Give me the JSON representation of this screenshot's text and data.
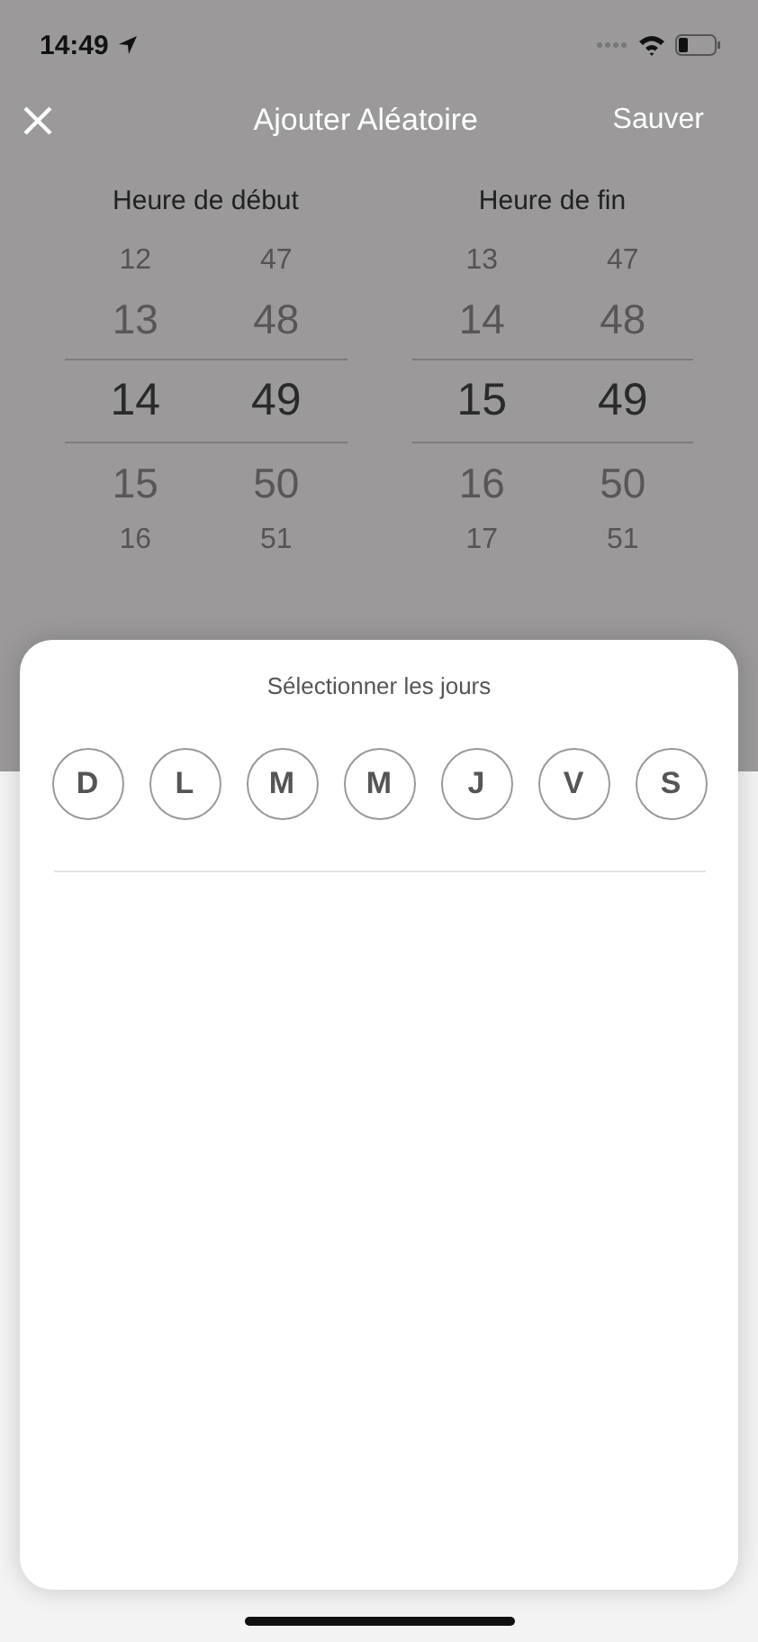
{
  "status_bar": {
    "time": "14:49"
  },
  "nav": {
    "title": "Ajouter Aléatoire",
    "action": "Sauver"
  },
  "pickers": [
    {
      "label": "Heure de début",
      "columns": [
        {
          "items": [
            {
              "value": "12",
              "selected": false
            },
            {
              "value": "13",
              "selected": false
            },
            {
              "value": "14",
              "selected": true
            },
            {
              "value": "15",
              "selected": false
            },
            {
              "value": "16",
              "selected": false
            }
          ]
        },
        {
          "items": [
            {
              "value": "47",
              "selected": false
            },
            {
              "value": "48",
              "selected": false
            },
            {
              "value": "49",
              "selected": true
            },
            {
              "value": "50",
              "selected": false
            },
            {
              "value": "51",
              "selected": false
            }
          ]
        }
      ]
    },
    {
      "label": "Heure de fin",
      "columns": [
        {
          "items": [
            {
              "value": "13",
              "selected": false
            },
            {
              "value": "14",
              "selected": false
            },
            {
              "value": "15",
              "selected": true
            },
            {
              "value": "16",
              "selected": false
            },
            {
              "value": "17",
              "selected": false
            }
          ]
        },
        {
          "items": [
            {
              "value": "47",
              "selected": false
            },
            {
              "value": "48",
              "selected": false
            },
            {
              "value": "49",
              "selected": true
            },
            {
              "value": "50",
              "selected": false
            },
            {
              "value": "51",
              "selected": false
            }
          ]
        }
      ]
    }
  ],
  "sheet": {
    "title": "Sélectionner les jours",
    "days": [
      {
        "label": "D",
        "selected": false
      },
      {
        "label": "L",
        "selected": false
      },
      {
        "label": "M",
        "selected": false
      },
      {
        "label": "M",
        "selected": false
      },
      {
        "label": "J",
        "selected": false
      },
      {
        "label": "V",
        "selected": false
      },
      {
        "label": "S",
        "selected": false
      }
    ]
  }
}
